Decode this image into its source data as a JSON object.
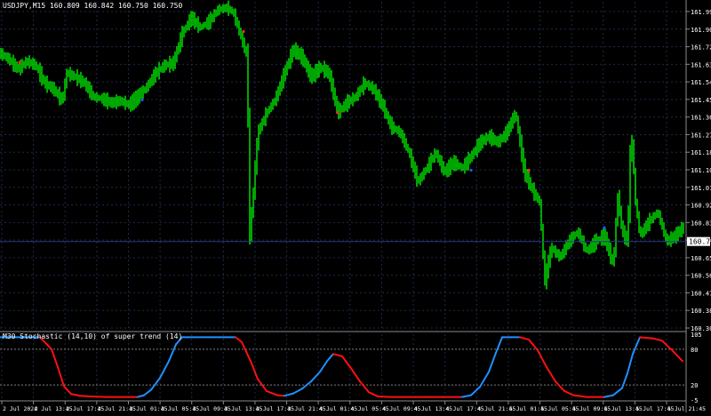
{
  "symbol_header": "USDJPY,M15  160.809 160.842 160.750 160.750",
  "indicator_header": "M30 Stochastic (14,10) of super trend (14)",
  "current_price_label": "160.750",
  "colors": {
    "background": "#000000",
    "candle": "#00ff00",
    "grid": "#1c2a4a",
    "axis_text": "#ffffff",
    "price_line": "#2a3a8a",
    "current_price_bg": "#ffffff",
    "stoch_up": "#1e90ff",
    "stoch_down": "#ff1010",
    "level_line": "#808080",
    "dot_red": "#ff3030",
    "dot_blue": "#3050ff"
  },
  "chart_data": [
    {
      "type": "candlestick",
      "title": "USDJPY,M15",
      "ylim": [
        160.3,
        161.96
      ],
      "price_ticks": [
        "161.990",
        "161.900",
        "161.720",
        "161.635",
        "161.545",
        "161.455",
        "161.365",
        "161.275",
        "161.185",
        "161.100",
        "161.010",
        "160.920",
        "160.830",
        "160.740",
        "160.655",
        "160.565",
        "160.475",
        "160.385",
        "160.300"
      ],
      "time_ticks": [
        "2 Jul 2024",
        "2 Jul 13:45",
        "2 Jul 17:45",
        "2 Jul 21:45",
        "3 Jul 01:45",
        "3 Jul 05:45",
        "3 Jul 09:45",
        "3 Jul 13:45",
        "3 Jul 17:45",
        "3 Jul 21:45",
        "4 Jul 01:45",
        "4 Jul 05:45",
        "4 Jul 09:45",
        "4 Jul 13:45",
        "4 Jul 17:45",
        "4 Jul 21:45",
        "5 Jul 01:45",
        "5 Jul 05:45",
        "5 Jul 09:45",
        "5 Jul 13:45",
        "5 Jul 17:45",
        "5 Jul 21:45"
      ],
      "close_path": [
        [
          0,
          161.7
        ],
        [
          10,
          161.67
        ],
        [
          20,
          161.62
        ],
        [
          30,
          161.66
        ],
        [
          40,
          161.64
        ],
        [
          50,
          161.55
        ],
        [
          60,
          161.52
        ],
        [
          70,
          161.46
        ],
        [
          75,
          161.6
        ],
        [
          85,
          161.58
        ],
        [
          95,
          161.55
        ],
        [
          105,
          161.48
        ],
        [
          115,
          161.47
        ],
        [
          125,
          161.45
        ],
        [
          135,
          161.46
        ],
        [
          145,
          161.44
        ],
        [
          155,
          161.48
        ],
        [
          165,
          161.53
        ],
        [
          175,
          161.6
        ],
        [
          185,
          161.64
        ],
        [
          195,
          161.65
        ],
        [
          205,
          161.8
        ],
        [
          215,
          161.88
        ],
        [
          225,
          161.83
        ],
        [
          235,
          161.86
        ],
        [
          245,
          161.92
        ],
        [
          255,
          161.93
        ],
        [
          262,
          161.91
        ],
        [
          270,
          161.8
        ],
        [
          278,
          161.68
        ],
        [
          281,
          160.78
        ],
        [
          285,
          161.0
        ],
        [
          290,
          161.3
        ],
        [
          300,
          161.4
        ],
        [
          310,
          161.47
        ],
        [
          320,
          161.6
        ],
        [
          330,
          161.72
        ],
        [
          340,
          161.68
        ],
        [
          350,
          161.58
        ],
        [
          360,
          161.63
        ],
        [
          370,
          161.6
        ],
        [
          380,
          161.4
        ],
        [
          390,
          161.45
        ],
        [
          400,
          161.48
        ],
        [
          410,
          161.55
        ],
        [
          420,
          161.52
        ],
        [
          430,
          161.44
        ],
        [
          440,
          161.33
        ],
        [
          450,
          161.3
        ],
        [
          460,
          161.2
        ],
        [
          470,
          161.05
        ],
        [
          480,
          161.12
        ],
        [
          490,
          161.2
        ],
        [
          500,
          161.1
        ],
        [
          510,
          161.15
        ],
        [
          520,
          161.12
        ],
        [
          530,
          161.18
        ],
        [
          540,
          161.25
        ],
        [
          550,
          161.28
        ],
        [
          560,
          161.25
        ],
        [
          570,
          161.3
        ],
        [
          580,
          161.4
        ],
        [
          585,
          161.25
        ],
        [
          590,
          161.1
        ],
        [
          600,
          161.0
        ],
        [
          607,
          160.95
        ],
        [
          613,
          160.55
        ],
        [
          620,
          160.72
        ],
        [
          630,
          160.67
        ],
        [
          640,
          160.75
        ],
        [
          650,
          160.8
        ],
        [
          660,
          160.7
        ],
        [
          670,
          160.75
        ],
        [
          680,
          160.78
        ],
        [
          690,
          160.63
        ],
        [
          695,
          160.98
        ],
        [
          700,
          160.8
        ],
        [
          706,
          160.75
        ],
        [
          710,
          161.33
        ],
        [
          715,
          160.95
        ],
        [
          720,
          160.78
        ],
        [
          730,
          160.85
        ],
        [
          740,
          160.9
        ],
        [
          750,
          160.75
        ],
        [
          760,
          160.78
        ],
        [
          768,
          160.82
        ]
      ]
    },
    {
      "type": "line",
      "title": "M30 Stochastic (14,10) of super trend (14)",
      "ylim": [
        -5,
        105
      ],
      "level_ticks": [
        "105",
        "80",
        "20",
        "-5"
      ],
      "levels": [
        80,
        20
      ],
      "series": [
        {
          "points": [
            [
              0,
              100
            ],
            [
              45,
              100
            ],
            [
              58,
              80
            ],
            [
              65,
              50
            ],
            [
              72,
              18
            ],
            [
              80,
              5
            ],
            [
              90,
              2
            ],
            [
              100,
              1
            ],
            [
              120,
              0
            ],
            [
              150,
              0
            ],
            [
              155,
              0
            ],
            [
              162,
              3
            ],
            [
              170,
              12
            ],
            [
              180,
              32
            ],
            [
              190,
              60
            ],
            [
              198,
              88
            ],
            [
              205,
              100
            ],
            [
              220,
              100
            ],
            [
              240,
              100
            ],
            [
              258,
              100
            ],
            [
              265,
              100
            ],
            [
              272,
              92
            ],
            [
              282,
              60
            ],
            [
              290,
              30
            ],
            [
              300,
              10
            ],
            [
              312,
              3
            ],
            [
              320,
              2
            ],
            [
              330,
              6
            ],
            [
              340,
              14
            ],
            [
              350,
              26
            ],
            [
              360,
              42
            ],
            [
              368,
              60
            ],
            [
              375,
              72
            ],
            [
              385,
              68
            ],
            [
              395,
              48
            ],
            [
              405,
              26
            ],
            [
              415,
              8
            ],
            [
              425,
              1
            ],
            [
              440,
              0
            ],
            [
              480,
              0
            ],
            [
              500,
              0
            ],
            [
              510,
              0
            ],
            [
              520,
              0
            ],
            [
              530,
              3
            ],
            [
              540,
              17
            ],
            [
              550,
              42
            ],
            [
              558,
              74
            ],
            [
              565,
              100
            ],
            [
              575,
              100
            ],
            [
              585,
              100
            ],
            [
              595,
              96
            ],
            [
              605,
              78
            ],
            [
              615,
              50
            ],
            [
              625,
              26
            ],
            [
              635,
              10
            ],
            [
              645,
              3
            ],
            [
              660,
              0
            ],
            [
              680,
              0
            ],
            [
              690,
              3
            ],
            [
              700,
              15
            ],
            [
              706,
              40
            ],
            [
              712,
              72
            ],
            [
              720,
              100
            ],
            [
              735,
              98
            ],
            [
              745,
              94
            ],
            [
              755,
              80
            ],
            [
              768,
              60
            ]
          ]
        }
      ]
    }
  ]
}
